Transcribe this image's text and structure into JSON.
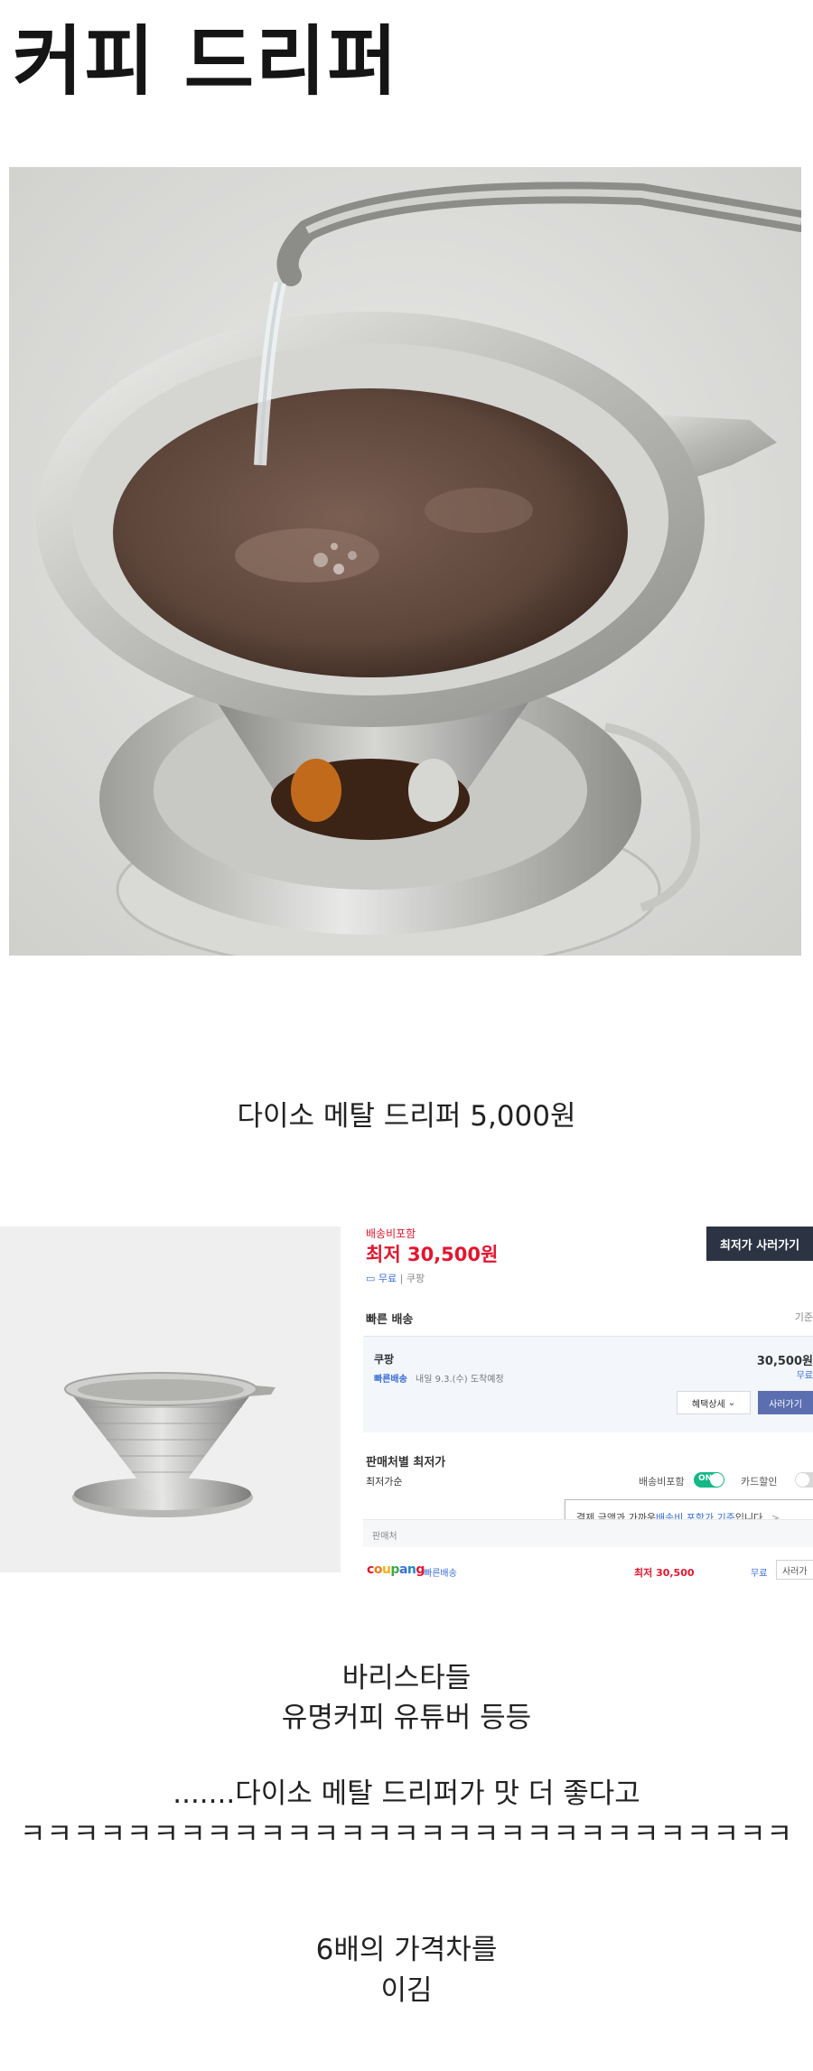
{
  "title": "커피 드리퍼",
  "caption_daiso": "다이소 메탈 드리퍼 5,000원",
  "shop": {
    "shipping_included": "배송비포함",
    "lowest_price": "최저 30,500원",
    "free_label": "무료",
    "seller_top": "쿠팡",
    "lowest_buy_button": "최저가 사러가기",
    "fast_delivery_heading": "빠른 배송",
    "standard_cut": "기준",
    "box_seller": "쿠팡",
    "box_fast_badge": "빠른배송",
    "box_eta": "내일 9.3.(수) 도착예정",
    "box_price": "30,500원",
    "box_free": "무료",
    "benefit_detail": "혜택상세",
    "buy_button": "사러가기",
    "by_seller_heading": "판매처별 최저가",
    "sort_lowest": "최저가순",
    "shipping_toggle_label": "배송비포함",
    "toggle_on": "ON",
    "card_discount_label": "카드할인",
    "tooltip_prefix": "결제 금액과 가까운 ",
    "tooltip_link": "배송비 포함가 기준",
    "tooltip_suffix": "입니다.",
    "seller_col": "판매처",
    "row_logo": "coupang",
    "row_fast": "빠른배송",
    "row_price": "최저 30,500",
    "row_free": "무료",
    "row_buy": "사러가"
  },
  "commentary": {
    "line1": "바리스타들",
    "line2": "유명커피 유튜버 등등",
    "line3": ".......다이소 메탈 드리퍼가 맛 더 좋다고",
    "line4": "ㅋㅋㅋㅋㅋㅋㅋㅋㅋㅋㅋㅋㅋㅋㅋㅋㅋㅋㅋㅋㅋㅋㅋㅋㅋㅋㅋㅋㅋ",
    "line5": "6배의 가격차를",
    "line6": "이김"
  },
  "colors": {
    "brand_red": "#e3162e",
    "link_blue": "#3a6ed8",
    "toggle_green": "#12b886",
    "button_dark": "#2c3343",
    "button_purple": "#5b6fb0"
  }
}
